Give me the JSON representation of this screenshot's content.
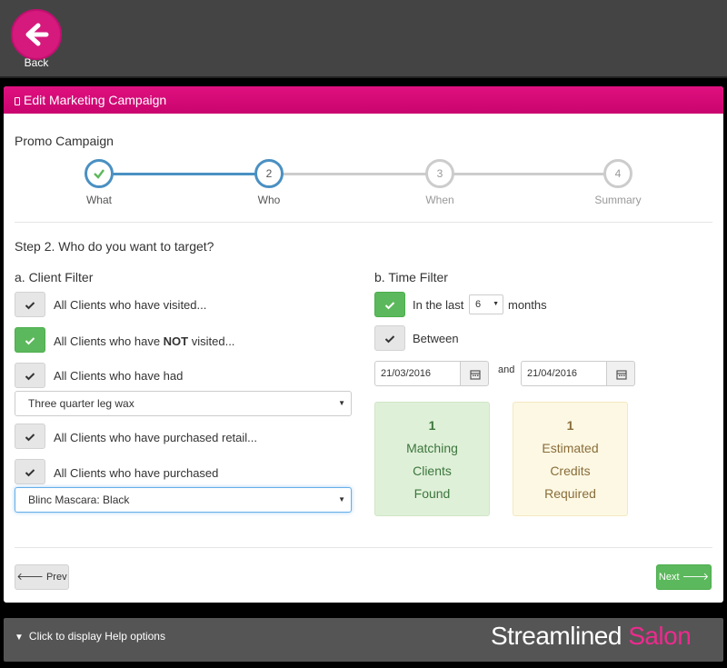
{
  "header": {
    "back_label": "Back"
  },
  "panel": {
    "title": "Edit Marketing Campaign"
  },
  "campaign": {
    "name": "Promo Campaign"
  },
  "wizard": {
    "steps": [
      {
        "number": "✓",
        "label": "What"
      },
      {
        "number": "2",
        "label": "Who"
      },
      {
        "number": "3",
        "label": "When"
      },
      {
        "number": "4",
        "label": "Summary"
      }
    ]
  },
  "step": {
    "question": "Step 2. Who do you want to target?"
  },
  "client_filter": {
    "title": "a. Client Filter",
    "options": [
      {
        "label": "All Clients who have visited..."
      },
      {
        "label_before": "All Clients who have ",
        "label_bold": "NOT",
        "label_after": " visited..."
      },
      {
        "label": "All Clients who have had"
      },
      {
        "label": "All Clients who have purchased retail..."
      },
      {
        "label": "All Clients who have purchased"
      }
    ],
    "service_select": "Three quarter leg wax",
    "product_select": "Blinc Mascara: Black"
  },
  "time_filter": {
    "title": "b. Time Filter",
    "last_prefix": "In the last",
    "last_value": "6",
    "last_suffix": "months",
    "between_label": "Between",
    "from_date": "21/03/2016",
    "and_label": "and",
    "to_date": "21/04/2016"
  },
  "stats": {
    "matching": {
      "count": "1",
      "line1": "Matching",
      "line2": "Clients",
      "line3": "Found"
    },
    "credits": {
      "count": "1",
      "line1": "Estimated",
      "line2": "Credits",
      "line3": "Required"
    }
  },
  "nav": {
    "prev_label": "Prev",
    "next_label": "Next"
  },
  "footer": {
    "help_label": "Click to display Help options",
    "brand_part1": "Streamlined ",
    "brand_part2": "Salon"
  },
  "colors": {
    "brand_pink": "#d6197c",
    "success_green": "#5cb85c",
    "wizard_blue": "#4a90c2"
  }
}
